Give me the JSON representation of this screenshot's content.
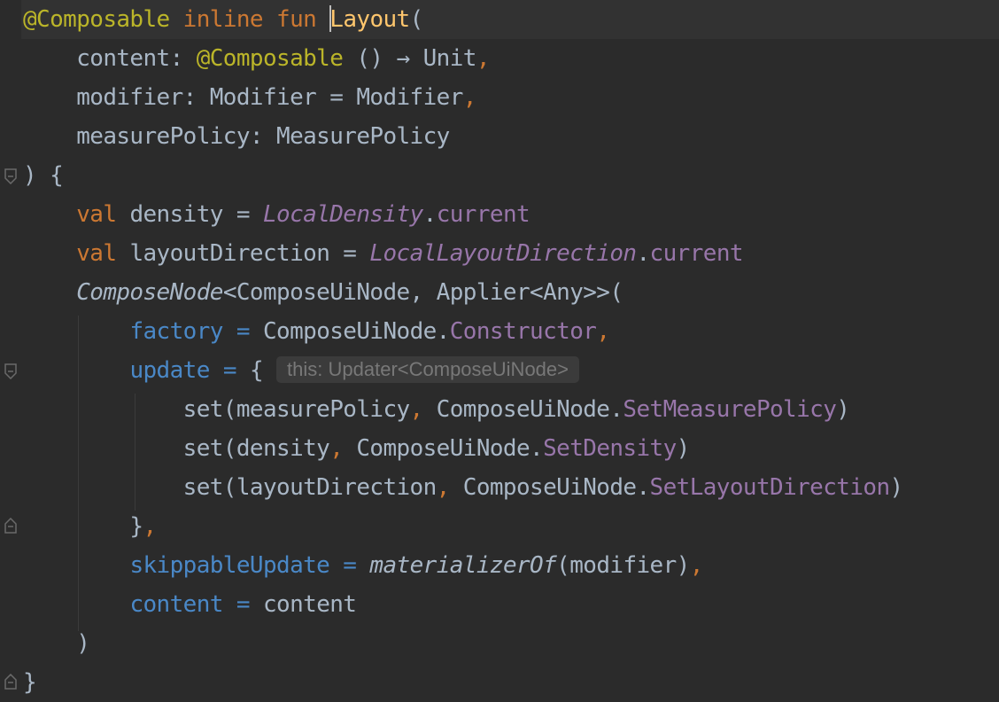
{
  "editor": {
    "lines": [
      {
        "tokens": [
          {
            "t": "@Composable",
            "c": "ann"
          },
          {
            "t": " ",
            "c": "txt"
          },
          {
            "t": "inline",
            "c": "kw"
          },
          {
            "t": " ",
            "c": "txt"
          },
          {
            "t": "fun",
            "c": "kw"
          },
          {
            "t": " ",
            "c": "txt"
          },
          {
            "t": "CARET",
            "c": "caret"
          },
          {
            "t": "Layout",
            "c": "fn"
          },
          {
            "t": "(",
            "c": "txt"
          }
        ]
      },
      {
        "tokens": [
          {
            "t": "    content: ",
            "c": "txt"
          },
          {
            "t": "@Composable",
            "c": "ann"
          },
          {
            "t": " () → Unit",
            "c": "txt"
          },
          {
            "t": ",",
            "c": "punc"
          }
        ]
      },
      {
        "tokens": [
          {
            "t": "    modifier: Modifier = Modifier",
            "c": "txt"
          },
          {
            "t": ",",
            "c": "punc"
          }
        ]
      },
      {
        "tokens": [
          {
            "t": "    measurePolicy: MeasurePolicy",
            "c": "txt"
          }
        ]
      },
      {
        "tokens": [
          {
            "t": ") {",
            "c": "txt"
          }
        ]
      },
      {
        "tokens": [
          {
            "t": "    ",
            "c": "txt"
          },
          {
            "t": "val",
            "c": "kw"
          },
          {
            "t": " density = ",
            "c": "txt"
          },
          {
            "t": "LocalDensity",
            "c": "purple ital"
          },
          {
            "t": ".",
            "c": "txt"
          },
          {
            "t": "current",
            "c": "purple"
          }
        ]
      },
      {
        "tokens": [
          {
            "t": "    ",
            "c": "txt"
          },
          {
            "t": "val",
            "c": "kw"
          },
          {
            "t": " layoutDirection = ",
            "c": "txt"
          },
          {
            "t": "LocalLayoutDirection",
            "c": "purple ital"
          },
          {
            "t": ".",
            "c": "txt"
          },
          {
            "t": "current",
            "c": "purple"
          }
        ]
      },
      {
        "tokens": [
          {
            "t": "    ",
            "c": "txt"
          },
          {
            "t": "ComposeNode",
            "c": "txt ital"
          },
          {
            "t": "<ComposeUiNode, Applier<Any>>(",
            "c": "txt"
          }
        ]
      },
      {
        "tokens": [
          {
            "t": "        ",
            "c": "txt"
          },
          {
            "t": "factory",
            "c": "blue"
          },
          {
            "t": " = ",
            "c": "blue"
          },
          {
            "t": "ComposeUiNode.",
            "c": "txt"
          },
          {
            "t": "Constructor",
            "c": "purple"
          },
          {
            "t": ",",
            "c": "punc"
          }
        ]
      },
      {
        "tokens": [
          {
            "t": "        ",
            "c": "txt"
          },
          {
            "t": "update",
            "c": "blue"
          },
          {
            "t": " = ",
            "c": "blue"
          },
          {
            "t": "{ ",
            "c": "txt"
          },
          {
            "t": "this: Updater<ComposeUiNode>",
            "c": "hint"
          }
        ]
      },
      {
        "tokens": [
          {
            "t": "            set(measurePolicy",
            "c": "txt"
          },
          {
            "t": ",",
            "c": "punc"
          },
          {
            "t": " ComposeUiNode.",
            "c": "txt"
          },
          {
            "t": "SetMeasurePolicy",
            "c": "purple"
          },
          {
            "t": ")",
            "c": "txt"
          }
        ]
      },
      {
        "tokens": [
          {
            "t": "            set(density",
            "c": "txt"
          },
          {
            "t": ",",
            "c": "punc"
          },
          {
            "t": " ComposeUiNode.",
            "c": "txt"
          },
          {
            "t": "SetDensity",
            "c": "purple"
          },
          {
            "t": ")",
            "c": "txt"
          }
        ]
      },
      {
        "tokens": [
          {
            "t": "            set(layoutDirection",
            "c": "txt"
          },
          {
            "t": ",",
            "c": "punc"
          },
          {
            "t": " ComposeUiNode.",
            "c": "txt"
          },
          {
            "t": "SetLayoutDirection",
            "c": "purple"
          },
          {
            "t": ")",
            "c": "txt"
          }
        ]
      },
      {
        "tokens": [
          {
            "t": "        }",
            "c": "txt"
          },
          {
            "t": ",",
            "c": "punc"
          }
        ]
      },
      {
        "tokens": [
          {
            "t": "        ",
            "c": "txt"
          },
          {
            "t": "skippableUpdate",
            "c": "blue"
          },
          {
            "t": " = ",
            "c": "blue"
          },
          {
            "t": "materializerOf",
            "c": "txt ital"
          },
          {
            "t": "(modifier)",
            "c": "txt"
          },
          {
            "t": ",",
            "c": "punc"
          }
        ]
      },
      {
        "tokens": [
          {
            "t": "        ",
            "c": "txt"
          },
          {
            "t": "content",
            "c": "blue"
          },
          {
            "t": " = ",
            "c": "blue"
          },
          {
            "t": "content",
            "c": "txt"
          }
        ]
      },
      {
        "tokens": [
          {
            "t": "    )",
            "c": "txt"
          }
        ]
      },
      {
        "tokens": [
          {
            "t": "}",
            "c": "txt"
          }
        ]
      }
    ]
  }
}
